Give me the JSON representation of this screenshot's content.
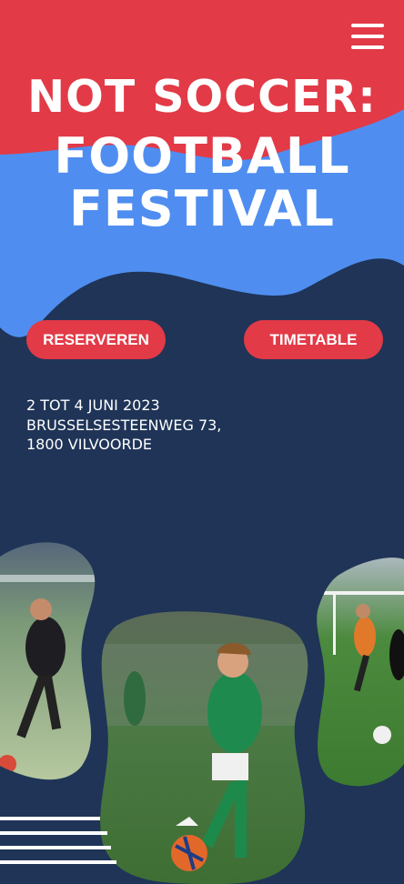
{
  "header": {
    "menu_icon": "hamburger-menu-icon",
    "title_line1": "NOT SOCCER:",
    "title_line2": "FOOTBALL",
    "title_line3": "FESTIVAL"
  },
  "actions": {
    "reserve_label": "RESERVEREN",
    "timetable_label": "TIMETABLE"
  },
  "event": {
    "dates": "2 TOT 4 JUNI 2023",
    "street": "BRUSSELSESTEENWEG 73,",
    "city": "1800 VILVOORDE"
  },
  "colors": {
    "red": "#e23a47",
    "light_blue": "#4f8ef0",
    "navy": "#1f3457",
    "white": "#ffffff"
  }
}
